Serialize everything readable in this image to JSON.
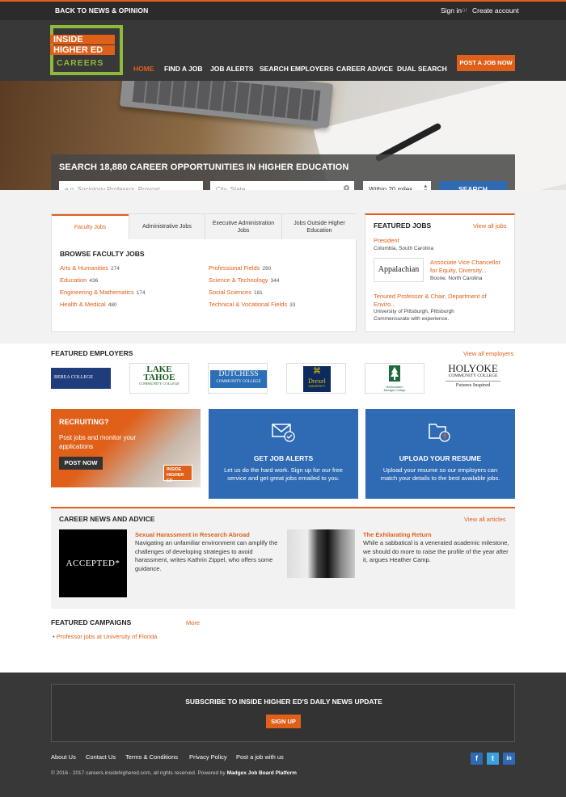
{
  "topbar": {
    "back": "BACK TO NEWS & OPINION",
    "sign_in": "Sign in",
    "or": "or",
    "create": "Create account"
  },
  "logo": {
    "line1": "INSIDE",
    "line2": "HIGHER ED",
    "line3": "CAREERS"
  },
  "nav": [
    "HOME",
    "FIND A JOB",
    "JOB ALERTS",
    "SEARCH EMPLOYERS",
    "CAREER ADVICE",
    "DUAL SEARCH"
  ],
  "post_job": "POST A JOB NOW",
  "search": {
    "title": "SEARCH 18,880 CAREER OPPORTUNITIES IN HIGHER EDUCATION",
    "keyword_placeholder": "e.g. Sociology Professor, Provost",
    "location_placeholder": "City, State",
    "radius": "Within 20 miles",
    "button": "SEARCH"
  },
  "tabs": [
    "Faculty Jobs",
    "Administrative Jobs",
    "Executive Administration Jobs",
    "Jobs Outside Higher Education"
  ],
  "browse_title": "BROWSE FACULTY JOBS",
  "categories_left": [
    {
      "name": "Arts & Humanities",
      "count": "274"
    },
    {
      "name": "Education",
      "count": "436"
    },
    {
      "name": "Engineering & Mathematics",
      "count": "174"
    },
    {
      "name": "Health & Medical",
      "count": "480"
    }
  ],
  "categories_right": [
    {
      "name": "Professional Fields",
      "count": "290"
    },
    {
      "name": "Science & Technology",
      "count": "344"
    },
    {
      "name": "Social Sciences",
      "count": "181"
    },
    {
      "name": "Technical & Vocational Fields",
      "count": "33"
    }
  ],
  "featured_jobs": {
    "title": "FEATURED JOBS",
    "view_all": "View all jobs",
    "job1": {
      "title": "President",
      "location": "Columbia, South Carolina"
    },
    "job2": {
      "logo": "Appalachian",
      "title1": "Associate Vice Chancellor",
      "title2": "for Equity, Diversity...",
      "location": "Boone, North Carolina"
    },
    "job3": {
      "title1": "Tenured Professor & Chair, Department of",
      "title2": "Enviro...",
      "location": "University of Pittsburgh, Pittsburgh",
      "salary": "Commensurate with experience."
    }
  },
  "employers": {
    "title": "FEATURED EMPLOYERS",
    "view_all": "View all employers",
    "e1": "BEREA COLLEGE",
    "e2a": "LAKE",
    "e2b": "TAHOE",
    "e2c": "COMMUNITY COLLEGE",
    "e3a": "DUTCHESS",
    "e3b": "COMMUNITY COLLEGE",
    "e4": "Drexel",
    "e4b": "UNIVERSITY",
    "e5": "Northwestern Michigan College",
    "e6a": "HOLYOKE",
    "e6b": "COMMUNITY COLLEGE",
    "e6c": "Futures Inspired"
  },
  "recruit": {
    "title": "RECRUITING?",
    "text": "Post jobs and monitor your applications",
    "button": "POST NOW",
    "badge1": "INSIDE",
    "badge2": "HIGHER ED"
  },
  "alerts": {
    "title": "GET JOB ALERTS",
    "text": "Let us do the hard work. Sign up for our free service and get great jobs emailed to you."
  },
  "resume": {
    "title": "UPLOAD YOUR RESUME",
    "text": "Upload your resume so our employers can match your details to the best available jobs."
  },
  "news": {
    "title": "CAREER NEWS AND ADVICE",
    "view_all": "View all articles",
    "a1": {
      "thumb": "ACCEPTED*",
      "title": "Sexual Harassment in Research Abroad",
      "text": "Navigating an unfamiliar environment can amplify the challenges of developing strategies to avoid harassment, writes Kathrin Zippel, who offers some guidance."
    },
    "a2": {
      "title": "The Exhilarating Return",
      "text": "While a sabbatical is a venerated academic milestone, we should do more to raise the profile of the year after it, argues Heather Camp."
    }
  },
  "campaigns": {
    "title": "FEATURED CAMPAIGNS",
    "more": "More",
    "item": "Professor jobs at University of Florida"
  },
  "subscribe": {
    "title": "SUBSCRIBE TO INSIDE HIGHER ED'S DAILY NEWS UPDATE",
    "button": "SIGN UP"
  },
  "footer_links": [
    "About Us",
    "Contact Us",
    "Terms & Conditions",
    "Privacy Policy",
    "Post a job with us"
  ],
  "copyright": "© 2016 - 2017 careers.insidehighered.com, all rights reserved. Powered by",
  "powered": "Madgex Job Board Platform",
  "social": [
    "f",
    "t",
    "in"
  ]
}
